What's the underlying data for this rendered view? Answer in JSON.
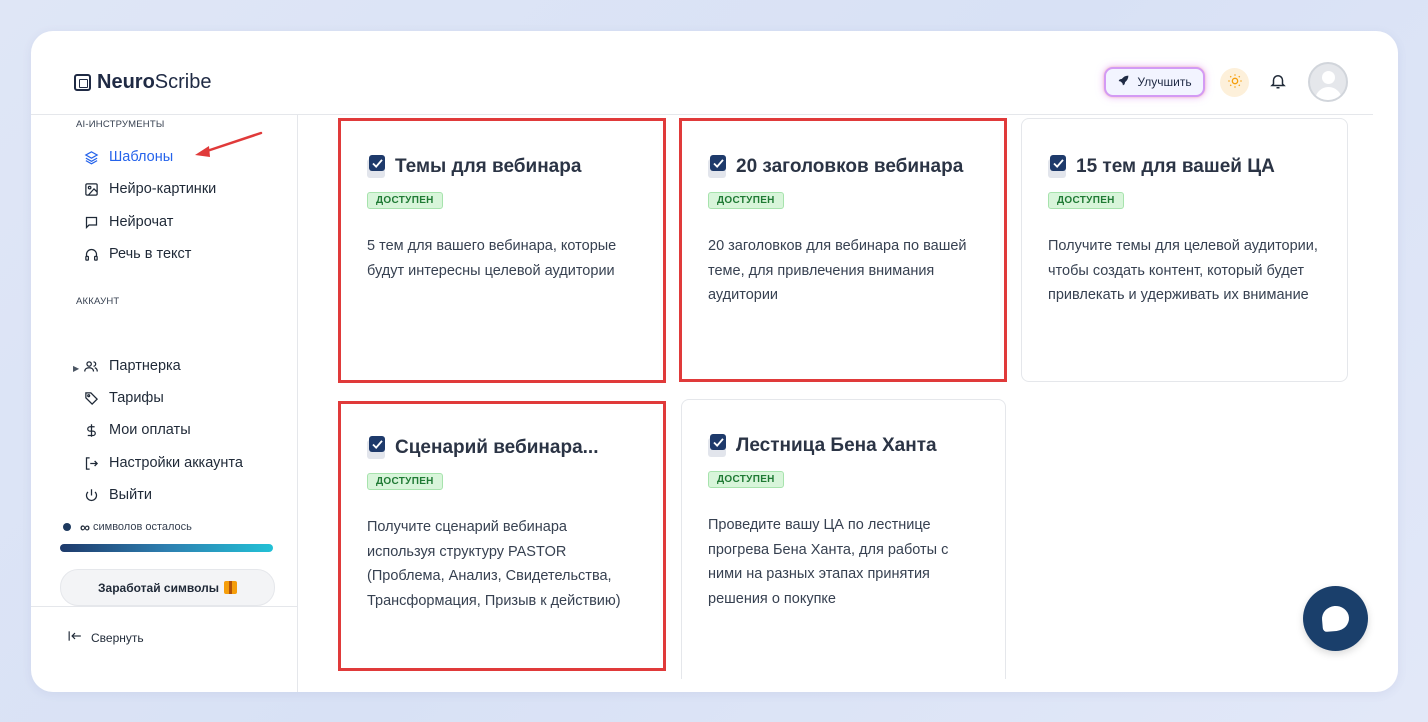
{
  "app": {
    "logo_bold": "Neuro",
    "logo_rest": "Scribe"
  },
  "header": {
    "upgrade_label": "Улучшить"
  },
  "sidebar": {
    "tools_label": "AI-ИНСТРУМЕНТЫ",
    "tools": [
      {
        "label": "Шаблоны",
        "icon": "layers-icon",
        "active": true
      },
      {
        "label": "Нейро-картинки",
        "icon": "image-icon"
      },
      {
        "label": "Нейрочат",
        "icon": "chat-icon"
      },
      {
        "label": "Речь в текст",
        "icon": "headphones-icon"
      }
    ],
    "account_label": "АККАУНТ",
    "account": [
      {
        "label": "Партнерка",
        "icon": "users-icon"
      },
      {
        "label": "Тарифы",
        "icon": "tag-icon"
      },
      {
        "label": "Мои оплаты",
        "icon": "dollar-icon"
      },
      {
        "label": "Настройки аккаунта",
        "icon": "settings-exit-icon"
      },
      {
        "label": "Выйти",
        "icon": "power-icon"
      }
    ],
    "credits_symbol": "∞",
    "credits_text": "символов осталось",
    "credits_fill": 1.0,
    "earn_label": "Заработай символы",
    "collapse_label": "Свернуть"
  },
  "cards": [
    {
      "title": "Темы для вебинара",
      "badge": "ДОСТУПЕН",
      "desc": "5 тем для вашего вебинара, которые будут интересны целевой аудитории",
      "highlighted": true
    },
    {
      "title": "20 заголовков вебинара",
      "badge": "ДОСТУПЕН",
      "desc": "20 заголовков для вебинара по вашей теме, для привлечения внимания аудитории",
      "highlighted": true
    },
    {
      "title": "15 тем для вашей ЦА",
      "badge": "ДОСТУПЕН",
      "desc": "Получите темы для целевой аудитории, чтобы создать контент, который будет привлекать и удерживать их внимание",
      "highlighted": false
    },
    {
      "title": "Сценарий вебинара...",
      "badge": "ДОСТУПЕН",
      "desc": "Получите сценарий вебинара используя структуру PASTOR (Проблема, Анализ, Свидетельства, Трансформация, Призыв к действию)",
      "highlighted": true
    },
    {
      "title": "Лестница Бена Ханта",
      "badge": "ДОСТУПЕН",
      "desc": "Проведите вашу ЦА по лестнице прогрева Бена Ханта, для работы с ними на разных этапах принятия решения о покупке",
      "highlighted": false
    }
  ],
  "colors": {
    "accent": "#2563eb",
    "highlight_border": "#e03a3a",
    "badge_bg": "#d8f5da",
    "badge_text": "#1f7a34",
    "brand_dark": "#1a3f6b"
  }
}
